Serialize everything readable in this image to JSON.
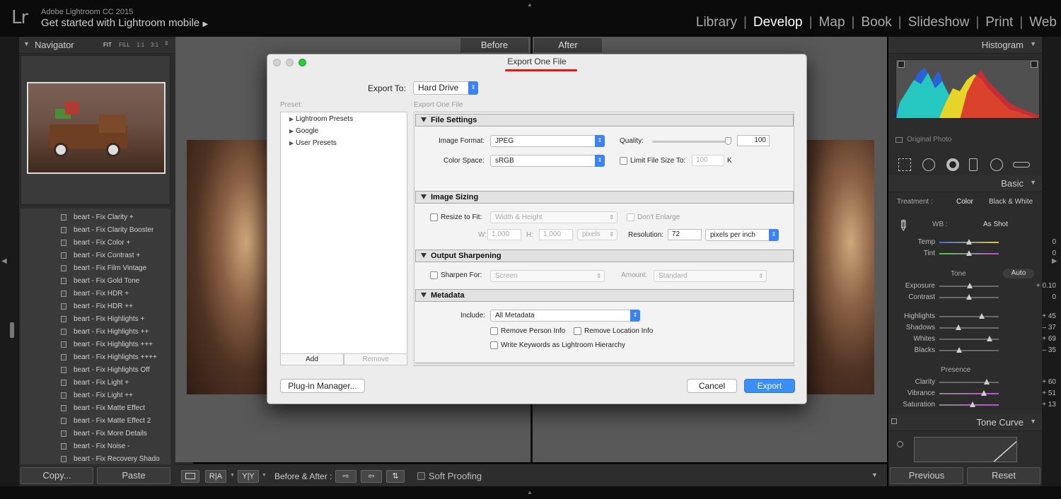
{
  "app": {
    "name": "Adobe Lightroom CC 2015",
    "identity": "Get started with Lightroom mobile",
    "logo": "Lr"
  },
  "modules": [
    "Library",
    "Develop",
    "Map",
    "Book",
    "Slideshow",
    "Print",
    "Web"
  ],
  "active_module": "Develop",
  "left_panel": {
    "navigator": {
      "title": "Navigator",
      "zoom": [
        "FIT",
        "FILL",
        "1:1",
        "3:1"
      ]
    },
    "presets": [
      "beart - Fix Clarity +",
      "beart - Fix Clarity Booster",
      "beart - Fix Color +",
      "beart - Fix Contrast +",
      "beart - Fix Film Vintage",
      "beart - Fix Gold Tone",
      "beart - Fix HDR +",
      "beart - Fix HDR ++",
      "beart - Fix Highlights +",
      "beart - Fix Highlights ++",
      "beart - Fix Highlights +++",
      "beart - Fix Highlights ++++",
      "beart - Fix Highlights Off",
      "beart - Fix Light +",
      "beart - Fix Light ++",
      "beart - Fix Matte Effect",
      "beart - Fix Matte Effect 2",
      "beart - Fix More Details",
      "beart - Fix Noise -",
      "beart - Fix Recovery Shado"
    ],
    "copy_label": "Copy...",
    "paste_label": "Paste"
  },
  "center": {
    "before_label": "Before",
    "after_label": "After",
    "toolbar": {
      "before_after_label": "Before & After :",
      "soft_proofing": "Soft Proofing"
    }
  },
  "right_panel": {
    "histogram_title": "Histogram",
    "original_photo": "Original Photo",
    "basic_title": "Basic",
    "treatment_label": "Treatment :",
    "treatment_color": "Color",
    "treatment_bw": "Black & White",
    "wb_label": "WB :",
    "wb_value": "As Shot",
    "tone_label": "Tone",
    "auto_label": "Auto",
    "presence_label": "Presence",
    "sliders": [
      {
        "label": "Temp",
        "value": "0",
        "pos": 0.5
      },
      {
        "label": "Tint",
        "value": "0",
        "pos": 0.5
      },
      {
        "label": "Exposure",
        "value": "+ 0.10",
        "pos": 0.51
      },
      {
        "label": "Contrast",
        "value": "0",
        "pos": 0.5
      },
      {
        "label": "Highlights",
        "value": "+ 45",
        "pos": 0.72
      },
      {
        "label": "Shadows",
        "value": "– 37",
        "pos": 0.32
      },
      {
        "label": "Whites",
        "value": "+ 69",
        "pos": 0.84
      },
      {
        "label": "Blacks",
        "value": "– 35",
        "pos": 0.33
      },
      {
        "label": "Clarity",
        "value": "+ 60",
        "pos": 0.8
      },
      {
        "label": "Vibrance",
        "value": "+ 51",
        "pos": 0.75
      },
      {
        "label": "Saturation",
        "value": "+ 13",
        "pos": 0.56
      }
    ],
    "tone_curve_title": "Tone Curve",
    "previous_label": "Previous",
    "reset_label": "Reset"
  },
  "dialog": {
    "title": "Export One File",
    "export_to_label": "Export To:",
    "export_to_value": "Hard Drive",
    "preset_label": "Preset:",
    "export_one_file_label": "Export One File",
    "presets": [
      "Lightroom Presets",
      "Google",
      "User Presets"
    ],
    "add_label": "Add",
    "remove_label": "Remove",
    "file_settings": {
      "title": "File Settings",
      "image_format_label": "Image Format:",
      "image_format_value": "JPEG",
      "quality_label": "Quality:",
      "quality_value": "100",
      "quality_level": 1.0,
      "color_space_label": "Color Space:",
      "color_space_value": "sRGB",
      "limit_label": "Limit File Size To:",
      "limit_value": "100",
      "limit_unit": "K"
    },
    "image_sizing": {
      "title": "Image Sizing",
      "resize_label": "Resize to Fit:",
      "resize_value": "Width & Height",
      "dont_enlarge": "Don't Enlarge",
      "w_label": "W:",
      "w_value": "1,000",
      "h_label": "H:",
      "h_value": "1,000",
      "unit": "pixels",
      "resolution_label": "Resolution:",
      "resolution_value": "72",
      "resolution_unit": "pixels per inch"
    },
    "output_sharpening": {
      "title": "Output Sharpening",
      "sharpen_label": "Sharpen For:",
      "sharpen_value": "Screen",
      "amount_label": "Amount:",
      "amount_value": "Standard"
    },
    "metadata": {
      "title": "Metadata",
      "include_label": "Include:",
      "include_value": "All Metadata",
      "remove_person": "Remove Person Info",
      "remove_location": "Remove Location Info",
      "write_keywords": "Write Keywords as Lightroom Hierarchy"
    },
    "plugin_manager": "Plug-in Manager...",
    "cancel": "Cancel",
    "export": "Export"
  }
}
